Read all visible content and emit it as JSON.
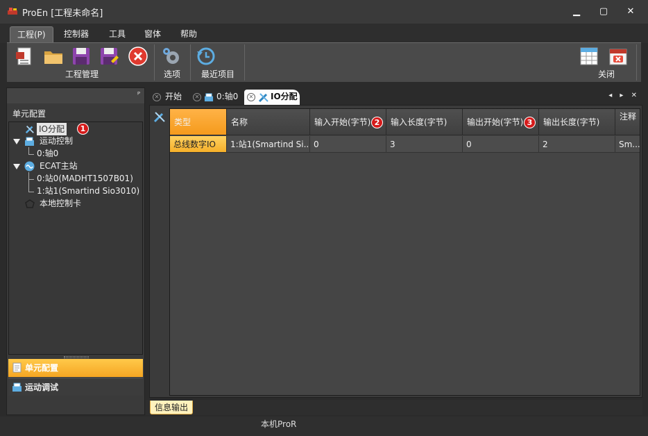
{
  "window": {
    "title": "ProEn [工程未命名]",
    "minimize": "▁",
    "maximize": "▢",
    "close": "✕"
  },
  "menu": {
    "items": [
      "工程(P)",
      "控制器",
      "工具",
      "窗体",
      "帮助"
    ]
  },
  "ribbon": {
    "groups": [
      {
        "label": "工程管理"
      },
      {
        "label": "选项"
      },
      {
        "label": "最近项目"
      },
      {
        "label": "关闭"
      }
    ]
  },
  "left_panel": {
    "pin": "ᴾ",
    "header": "单元配置",
    "tree": [
      {
        "label": "IO分配"
      },
      {
        "label": "运动控制"
      },
      {
        "label": "0:轴0"
      },
      {
        "label": "ECAT主站"
      },
      {
        "label": "0:站0(MADHT1507B01)"
      },
      {
        "label": "1:站1(Smartind Sio3010)"
      },
      {
        "label": "本地控制卡"
      }
    ],
    "nav": [
      {
        "label": "单元配置"
      },
      {
        "label": "运动调试"
      }
    ]
  },
  "badges": [
    "1",
    "2",
    "3"
  ],
  "tabs": [
    {
      "label": "开始"
    },
    {
      "label": "0:轴0"
    },
    {
      "label": "IO分配"
    }
  ],
  "tab_nav": "◂ ▸ ✕",
  "grid": {
    "columns": [
      "类型",
      "名称",
      "输入开始(字节)",
      "输入长度(字节)",
      "输出开始(字节)",
      "输出长度(字节)",
      "注释"
    ],
    "rows": [
      [
        "总线数字IO",
        "1:站1(Smartind Si...",
        "0",
        "3",
        "0",
        "2",
        "Sm..."
      ]
    ]
  },
  "bottom_tab": "信息输出",
  "status": "本机ProR",
  "colors": {
    "accent": "#f5a623",
    "badge": "#d51a1a"
  }
}
